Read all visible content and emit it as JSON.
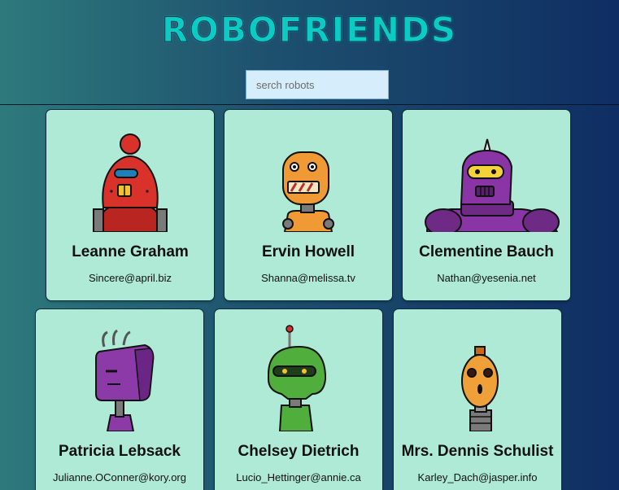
{
  "header": {
    "title": "ROBOFRIENDS"
  },
  "search": {
    "placeholder": "serch robots",
    "value": ""
  },
  "robots": [
    {
      "name": "Leanne Graham",
      "email": "Sincere@april.biz",
      "robot_color": "#d8322b"
    },
    {
      "name": "Ervin Howell",
      "email": "Shanna@melissa.tv",
      "robot_color": "#f09a35"
    },
    {
      "name": "Clementine Bauch",
      "email": "Nathan@yesenia.net",
      "robot_color": "#8a35a6"
    },
    {
      "name": "Patricia Lebsack",
      "email": "Julianne.OConner@kory.org",
      "robot_color": "#8c3aa8"
    },
    {
      "name": "Chelsey Dietrich",
      "email": "Lucio_Hettinger@annie.ca",
      "robot_color": "#4fae3c"
    },
    {
      "name": "Mrs. Dennis Schulist",
      "email": "Karley_Dach@jasper.info",
      "robot_color": "#f0a038"
    }
  ]
}
